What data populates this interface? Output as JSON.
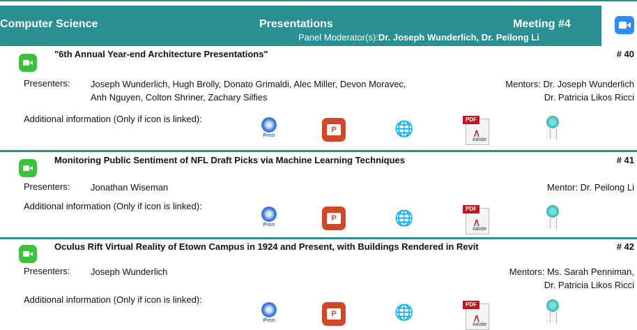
{
  "header": {
    "department": "Computer Science",
    "category": "Presentations",
    "meeting": "Meeting #4",
    "moderator_label": "Panel Moderator(s):",
    "moderators": "Dr. Joseph Wunderlich, Dr. Peilong Li"
  },
  "labels": {
    "presenters": "Presenters:",
    "additional_info": "Additional information (Only if icon is linked):",
    "prezi": "Prezi",
    "ppt": "P",
    "pdf": "PDF",
    "adobe": "Adobe"
  },
  "entries": [
    {
      "title": "\"6th Annual Year-end Architecture Presentations\"",
      "number": "# 40",
      "presenters_line1": "Joseph Wunderlich, Hugh Brolly, Donato Grimaldi, Alec Miller, Devon Moravec,",
      "presenters_line2": "Anh Nguyen, Colton Shriner, Zachary Silfies",
      "mentors_line1": "Mentors: Dr. Joseph Wunderlich",
      "mentors_line2": "Dr. Patricia Likos Ricci"
    },
    {
      "title": "Monitoring Public Sentiment of NFL Draft Picks via Machine Learning Techniques",
      "number": "# 41",
      "presenters_line1": "Jonathan Wiseman",
      "presenters_line2": "",
      "mentors_line1": "Mentor: Dr. Peilong Li",
      "mentors_line2": ""
    },
    {
      "title": "Oculus Rift Virtual Reality of Etown Campus in 1924 and Present, with Buildings Rendered in Revit",
      "number": "# 42",
      "presenters_line1": "Joseph Wunderlich",
      "presenters_line2": "",
      "mentors_line1": "Mentors: Ms. Sarah Penniman,",
      "mentors_line2": "Dr. Patricia Likos Ricci"
    }
  ],
  "icons": {
    "zoom": "zoom-icon",
    "camera": "video-camera-icon",
    "prezi": "prezi-icon",
    "powerpoint": "powerpoint-icon",
    "web": "globe-cursor-icon",
    "pdf": "pdf-icon",
    "poster": "lightbulb-icon"
  },
  "colors": {
    "header_bg": "#2a8f92",
    "camera_green": "#39c33d",
    "zoom_blue": "#2d8cff",
    "ppt_red": "#d24726",
    "pdf_red": "#c1151b"
  }
}
